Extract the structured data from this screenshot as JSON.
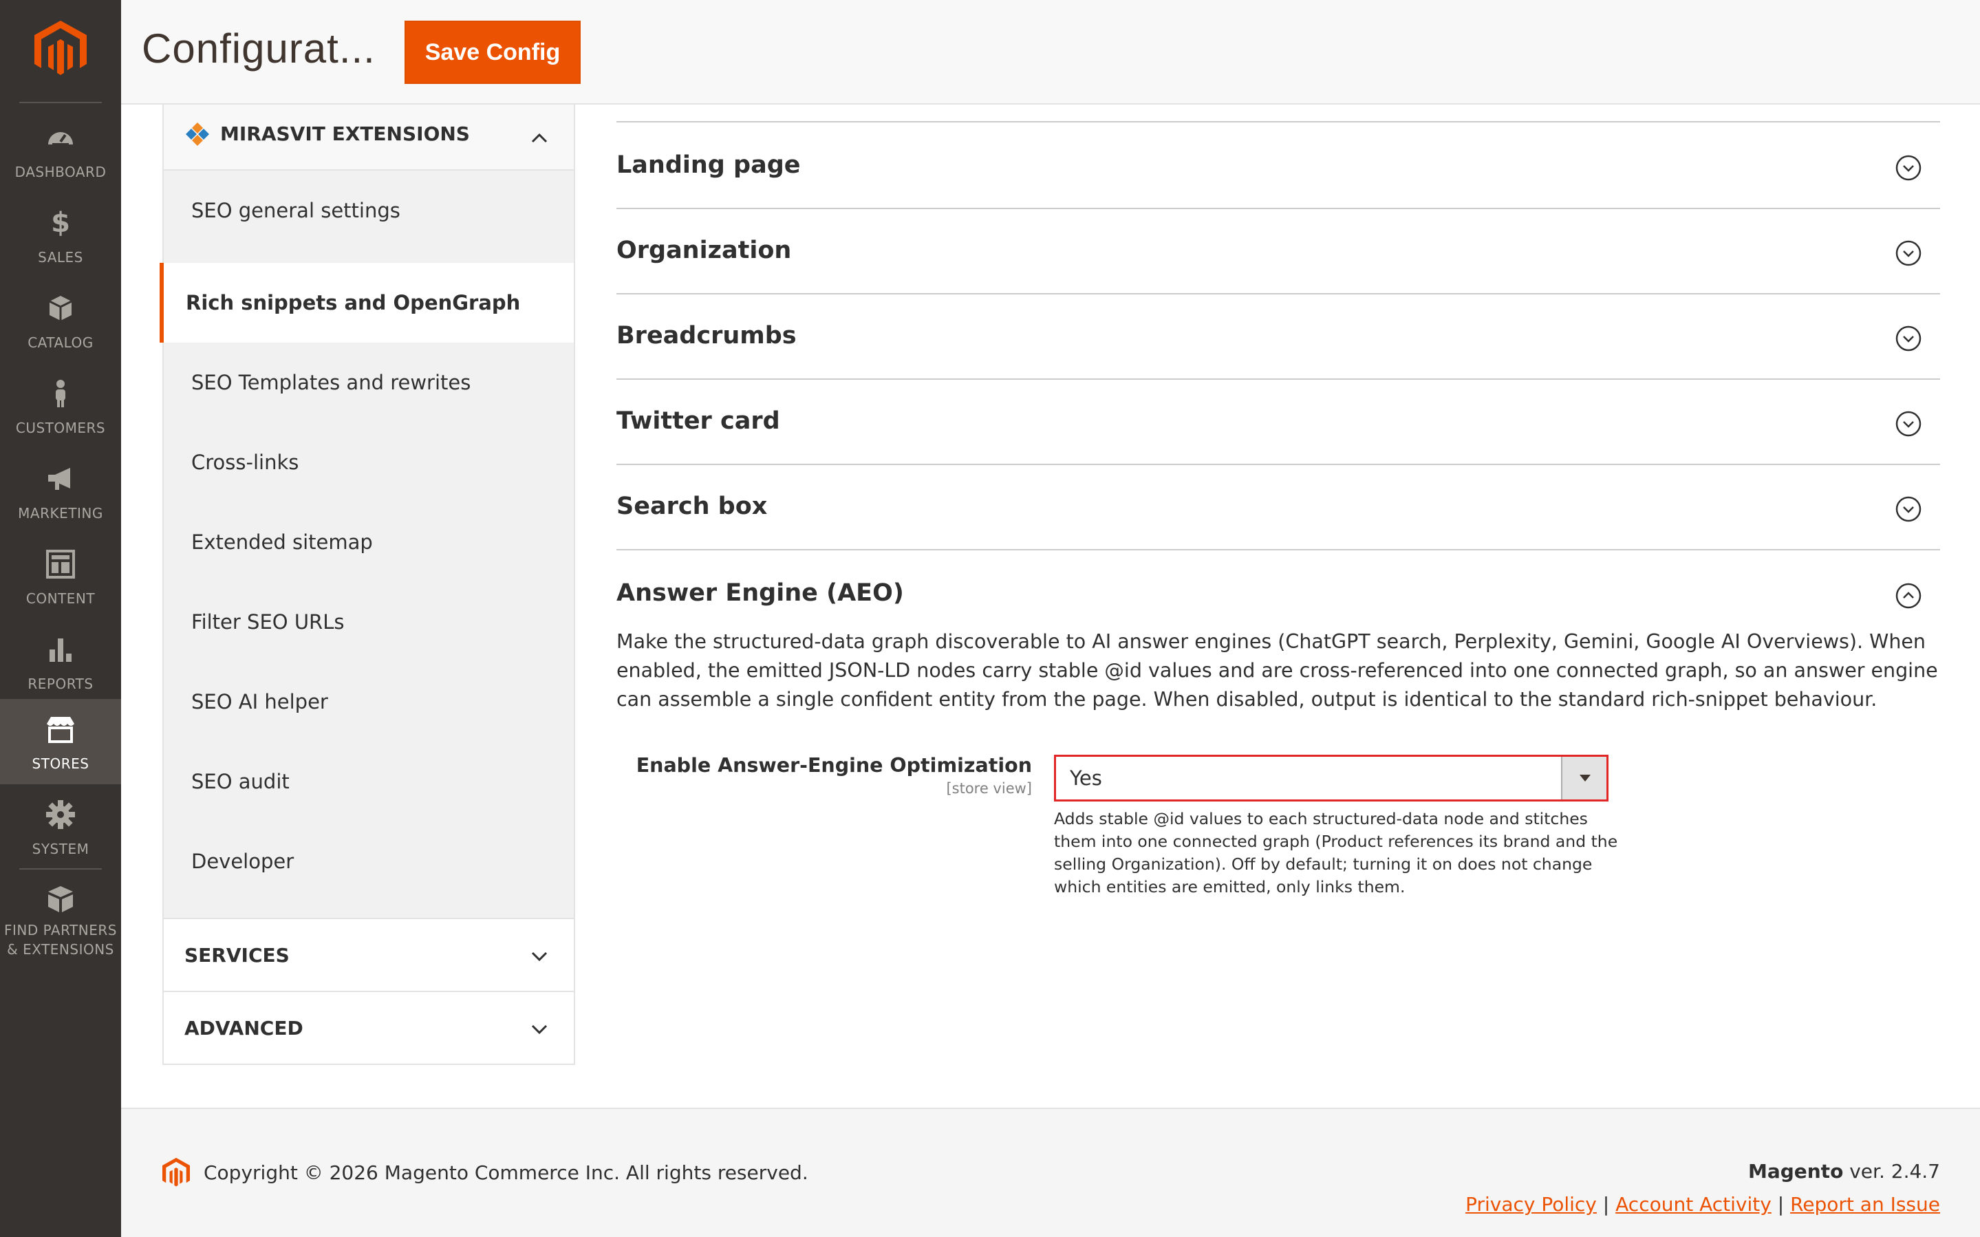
{
  "nav": {
    "items": [
      {
        "label": "DASHBOARD",
        "icon": "dashboard-icon"
      },
      {
        "label": "SALES",
        "icon": "dollar-icon"
      },
      {
        "label": "CATALOG",
        "icon": "cube-icon"
      },
      {
        "label": "CUSTOMERS",
        "icon": "person-icon"
      },
      {
        "label": "MARKETING",
        "icon": "megaphone-icon"
      },
      {
        "label": "CONTENT",
        "icon": "layout-icon"
      },
      {
        "label": "REPORTS",
        "icon": "bar-chart-icon"
      },
      {
        "label": "STORES",
        "icon": "store-icon",
        "active": true
      },
      {
        "label": "SYSTEM",
        "icon": "gear-icon"
      },
      {
        "label_line1": "FIND PARTNERS",
        "label_line2": "& EXTENSIONS",
        "icon": "boxes-icon"
      }
    ],
    "accent": "#eb5202"
  },
  "header": {
    "title": "Configurat...",
    "save_label": "Save Config"
  },
  "sidebar": {
    "group_title": "MIRASVIT EXTENSIONS",
    "items": [
      {
        "label": "SEO general settings"
      },
      {
        "label": "Rich snippets and OpenGraph",
        "active": true
      },
      {
        "label": "SEO Templates and rewrites"
      },
      {
        "label": "Cross-links"
      },
      {
        "label": "Extended sitemap"
      },
      {
        "label": "Filter SEO URLs"
      },
      {
        "label": "SEO AI helper"
      },
      {
        "label": "SEO audit"
      },
      {
        "label": "Developer"
      }
    ],
    "services_title": "SERVICES",
    "advanced_title": "ADVANCED"
  },
  "sections": [
    {
      "title": "Landing page"
    },
    {
      "title": "Organization"
    },
    {
      "title": "Breadcrumbs"
    },
    {
      "title": "Twitter card"
    },
    {
      "title": "Search box"
    }
  ],
  "aeo": {
    "title": "Answer Engine (AEO)",
    "description": "Make the structured-data graph discoverable to AI answer engines (ChatGPT search, Perplexity, Gemini, Google AI Overviews). When enabled, the emitted JSON-LD nodes carry stable @id values and are cross-referenced into one connected graph, so an answer engine can assemble a single confident entity from the page. When disabled, output is identical to the standard rich-snippet behaviour.",
    "field_label": "Enable Answer-Engine Optimization",
    "field_scope": "[store view]",
    "field_value": "Yes",
    "field_note": "Adds stable @id values to each structured-data node and stitches them into one connected graph (Product references its brand and the selling Organization). Off by default; turning it on does not change which entities are emitted, only links them."
  },
  "footer": {
    "copyright": "Copyright © 2026 Magento Commerce Inc. All rights reserved.",
    "brand": "Magento",
    "version": " ver. 2.4.7",
    "privacy": "Privacy Policy",
    "activity": " Account Activity",
    "report": "Report an Issue",
    "sep": "|"
  }
}
